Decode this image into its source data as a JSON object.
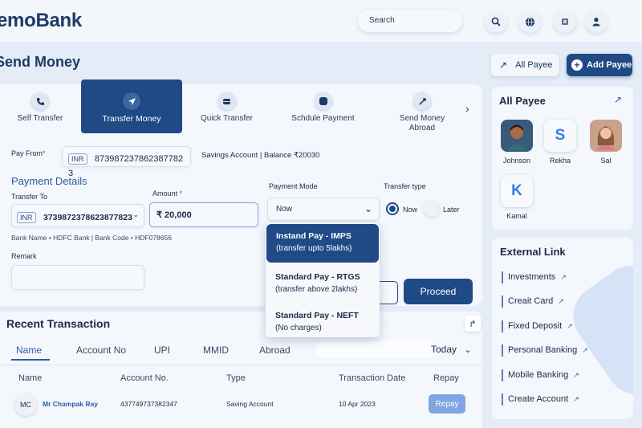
{
  "brand": "emoBank",
  "search": {
    "placeholder": "Search"
  },
  "header": {
    "title": "Send Money",
    "all_payee_btn": "All Payee",
    "add_payee_btn": "Add Payee"
  },
  "tabs": [
    {
      "label": "Self Transfer",
      "icon": "phone-icon"
    },
    {
      "label": "Transfer Money",
      "icon": "send-arrow-icon"
    },
    {
      "label": "Quick Transfer",
      "icon": "wallet-icon"
    },
    {
      "label": "Schdule Payment",
      "icon": "calendar-icon"
    },
    {
      "label": "Send Money Abroad",
      "icon": "globe-arrow-icon"
    }
  ],
  "pay_from": {
    "label": "Pay From",
    "currency": "INR",
    "account": "873987237862387782 3",
    "info": "Savings Account | Balance ₹20030"
  },
  "payment_details": {
    "title": "Payment Details",
    "transfer_to_label": "Transfer To",
    "transfer_to_currency": "INR",
    "transfer_to_value": "3739872378623877823",
    "amount_label": "Amount",
    "amount_value": "₹ 20,000",
    "bank_info": "Bank Name • HDFC Bank | Bank Code • HDF078656",
    "remark_label": "Remark",
    "payment_mode_label": "Payment Mode",
    "payment_mode_value": "Now",
    "transfer_type_label": "Transfer type",
    "transfer_type_now": "Now",
    "transfer_type_later": "Later",
    "proceed_label": "Proceed"
  },
  "payment_mode_options": [
    {
      "title": "Instand Pay - IMPS",
      "sub": "(transfer upto 5lakhs)"
    },
    {
      "title": "Standard Pay - RTGS",
      "sub": "(transfer above 2lakhs)"
    },
    {
      "title": "Standard Pay - NEFT",
      "sub": "(No charges)"
    }
  ],
  "recent": {
    "title": "Recent Transaction",
    "filters": [
      "Name",
      "Account No",
      "UPI",
      "MMID",
      "Abroad"
    ],
    "period": "Today",
    "columns": [
      "Name",
      "Account No.",
      "Type",
      "Transaction Date",
      "Repay"
    ],
    "rows": [
      {
        "initials": "MC",
        "name": "Mr Champak Ray",
        "account": "437749737382347",
        "type": "Saving Account",
        "date": "10 Apr 2023",
        "action": "Repay"
      }
    ]
  },
  "all_payee": {
    "title": "All Payee",
    "payees": [
      {
        "name": "Johnson",
        "avatar": "man-avatar-icon"
      },
      {
        "name": "Rekha",
        "initial": "S"
      },
      {
        "name": "Sal",
        "avatar": "woman-avatar-icon"
      },
      {
        "name": "Kamal",
        "initial": "K"
      }
    ]
  },
  "external_links": {
    "title": "External Link",
    "items": [
      "Investments",
      "Creait Card",
      "Fixed Deposit",
      "Personal Banking",
      "Mobile Banking",
      "Create Account"
    ]
  },
  "colors": {
    "primary": "#1f4a86",
    "background": "#e4ecf7",
    "card": "#f4f7fc",
    "accent_light": "#7fa6e0"
  }
}
